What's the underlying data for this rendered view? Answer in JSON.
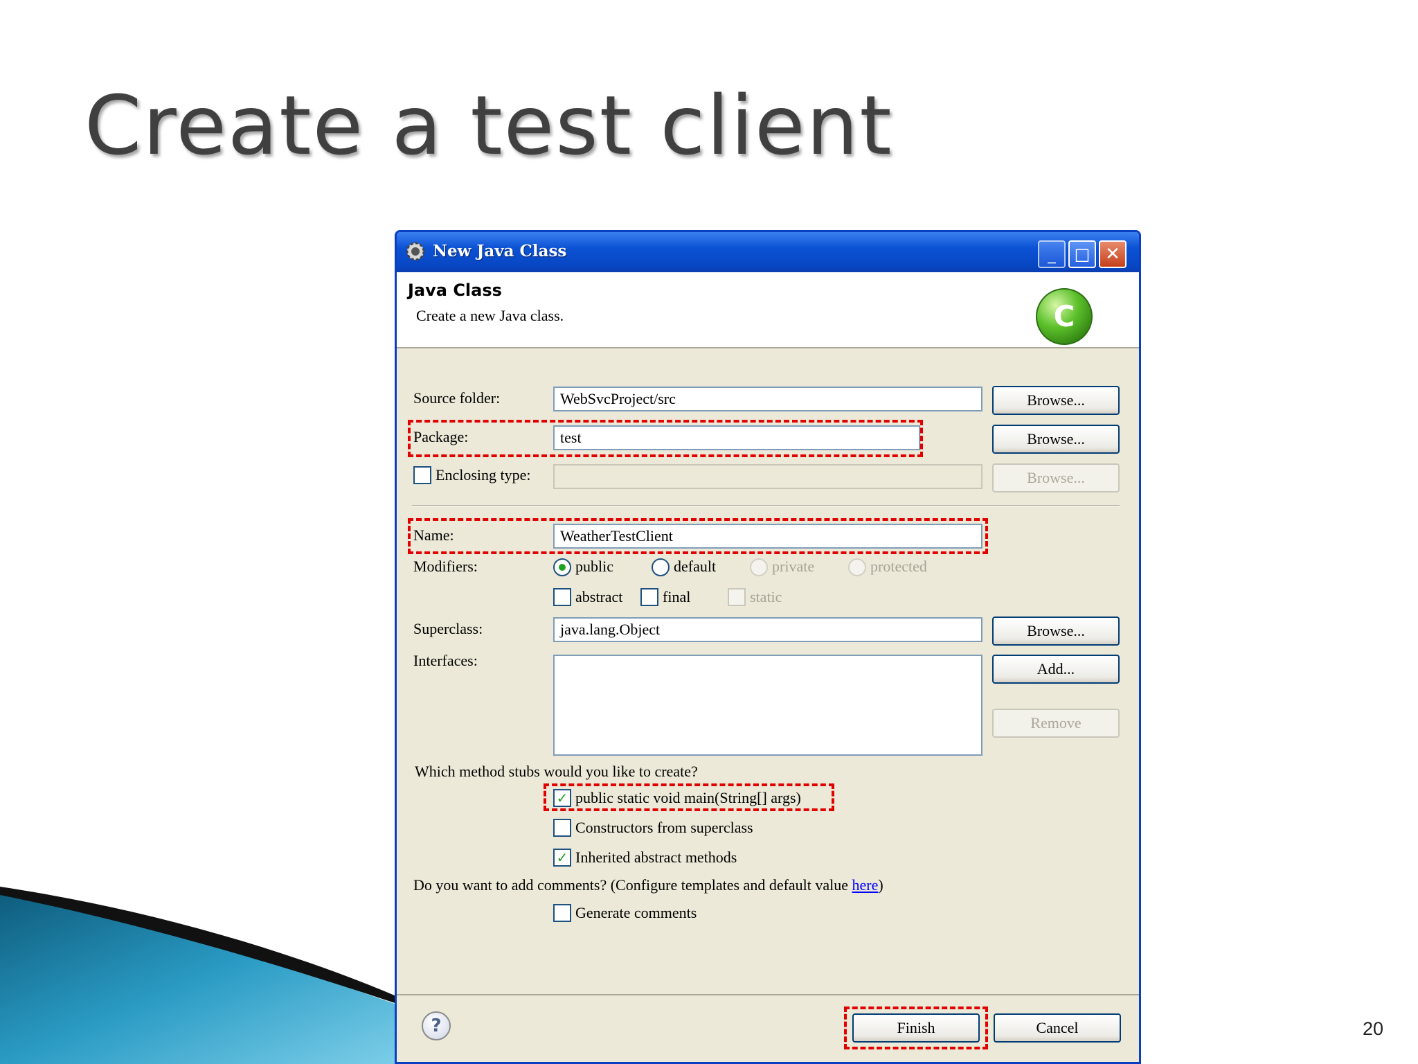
{
  "slide": {
    "title": "Create a test client",
    "page_number": "20"
  },
  "window": {
    "title": "New Java Class",
    "minimize_symbol": "_",
    "maximize_symbol": "□",
    "close_symbol": "✕"
  },
  "banner": {
    "title": "Java Class",
    "subtitle": "Create a new Java class.",
    "logo_letter": "C"
  },
  "form": {
    "source_folder": {
      "label": "Source folder:",
      "value": "WebSvcProject/src",
      "browse": "Browse..."
    },
    "package": {
      "label": "Package:",
      "value": "test",
      "browse": "Browse..."
    },
    "enclosing_type": {
      "label": "Enclosing type:",
      "value": "",
      "browse": "Browse...",
      "checked": false
    },
    "name": {
      "label": "Name:",
      "value": "WeatherTestClient"
    },
    "modifiers": {
      "label": "Modifiers:",
      "public": "public",
      "default": "default",
      "private": "private",
      "protected": "protected",
      "selected": "public",
      "abstract": "abstract",
      "final": "final",
      "static": "static"
    },
    "superclass": {
      "label": "Superclass:",
      "value": "java.lang.Object",
      "browse": "Browse..."
    },
    "interfaces": {
      "label": "Interfaces:",
      "add": "Add...",
      "remove": "Remove"
    },
    "stubs": {
      "question": "Which method stubs would you like to create?",
      "main": "public static void main(String[] args)",
      "main_checked": true,
      "constructors": "Constructors from superclass",
      "constructors_checked": false,
      "inherited": "Inherited abstract methods",
      "inherited_checked": true
    },
    "comments": {
      "question_before": "Do you want to add comments? (Configure templates and default value ",
      "link": "here",
      "question_after": ")",
      "generate": "Generate comments",
      "generate_checked": false
    }
  },
  "footer": {
    "help_symbol": "?",
    "finish": "Finish",
    "cancel": "Cancel"
  },
  "check_symbol": "✓",
  "colors": {
    "highlight": "#e00000",
    "titlebar": "#0b52d4",
    "dialog_bg": "#ece9d8"
  }
}
